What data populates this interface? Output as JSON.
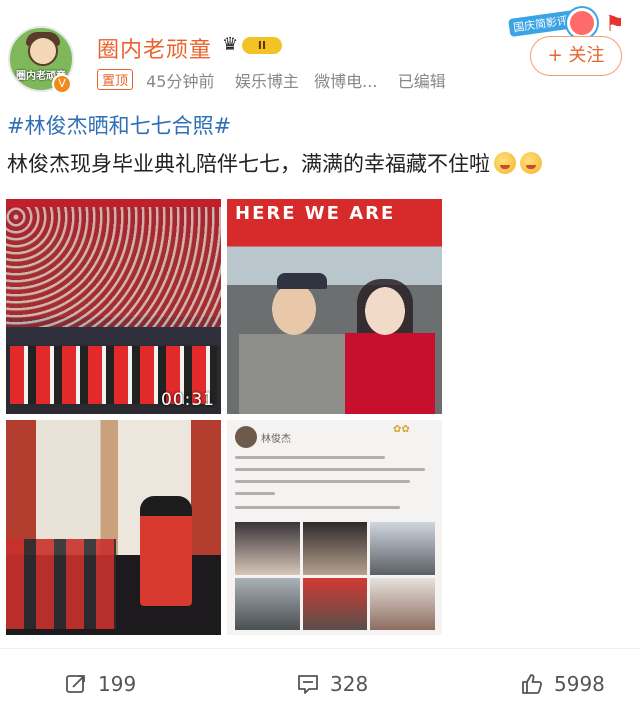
{
  "author": {
    "name": "圈内老顽童",
    "avatar_text": "圈内老顽童",
    "level": "II",
    "verified": "V"
  },
  "meta": {
    "pin_label": "置顶",
    "time": "45分钟前",
    "role": "娱乐博主",
    "source": "微博电...",
    "edited": "已编辑"
  },
  "event_sticker": {
    "text": "国庆简影评论"
  },
  "follow_button": {
    "label": "+ 关注"
  },
  "post": {
    "hashtag": "#林俊杰晒和七七合照#",
    "text": "林俊杰现身毕业典礼陪伴七七，满满的幸福藏不住啦"
  },
  "media": {
    "video_duration": "00:31",
    "tile2_sign": "HERE WE ARE",
    "tile4_name": "林俊杰"
  },
  "actions": {
    "reposts": "199",
    "comments": "328",
    "likes": "5998"
  },
  "colors": {
    "username": "#e8642c",
    "hashtag": "#2f6fb6",
    "follow": "#e8642c"
  }
}
